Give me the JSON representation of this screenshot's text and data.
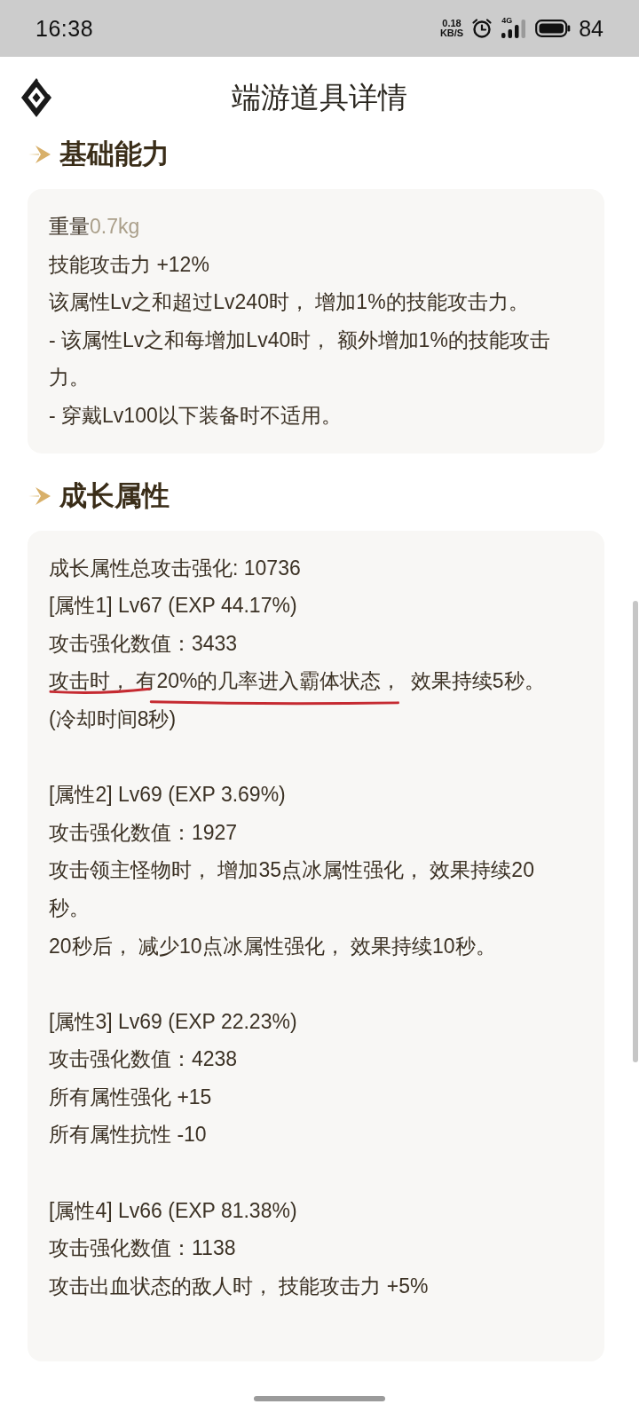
{
  "status_bar": {
    "time": "16:38",
    "net_speed": "0.18",
    "net_speed_unit": "KB/S",
    "network_type": "4G",
    "battery": "84"
  },
  "header": {
    "title": "端游道具详情"
  },
  "basic_ability": {
    "title": "基础能力",
    "weight": {
      "label": "重量",
      "value": "0.7kg"
    },
    "lines": [
      "技能攻击力 +12%",
      "该属性Lv之和超过Lv240时， 增加1%的技能攻击力。",
      "- 该属性Lv之和每增加Lv40时， 额外增加1%的技能攻击力。",
      "- 穿戴Lv100以下装备时不适用。"
    ]
  },
  "growth_attributes": {
    "title": "成长属性",
    "total": "成长属性总攻击强化: 10736",
    "attributes": [
      {
        "header": "[属性1] Lv67 (EXP 44.17%)",
        "value": "攻击强化数值：3433",
        "effects": [
          {
            "parts": [
              {
                "text": "攻击时， 有20%的几率进入霸体状态，",
                "underlined": true
              },
              {
                "text": "效果持续5秒。",
                "underlined": false
              }
            ]
          },
          {
            "parts": [
              {
                "text": "(冷却时间8秒)",
                "underlined": false
              }
            ]
          }
        ]
      },
      {
        "header": "[属性2] Lv69 (EXP 3.69%)",
        "value": "攻击强化数值：1927",
        "effects": [
          {
            "parts": [
              {
                "text": "攻击领主怪物时， 增加35点冰属性强化， 效果持续20秒。",
                "underlined": false
              }
            ]
          },
          {
            "parts": [
              {
                "text": "20秒后， 减少10点冰属性强化， 效果持续10秒。",
                "underlined": false
              }
            ]
          }
        ]
      },
      {
        "header": "[属性3] Lv69 (EXP 22.23%)",
        "value": "攻击强化数值：4238",
        "effects": [
          {
            "parts": [
              {
                "text": "所有属性强化 +15",
                "underlined": false
              }
            ]
          },
          {
            "parts": [
              {
                "text": "所有属性抗性 -10",
                "underlined": false
              }
            ]
          }
        ]
      },
      {
        "header": "[属性4] Lv66 (EXP 81.38%)",
        "value": "攻击强化数值：1138",
        "effects": [
          {
            "parts": [
              {
                "text": "攻击出血状态的敌人时， 技能攻击力 +5%",
                "underlined": false
              }
            ]
          }
        ]
      }
    ]
  }
}
